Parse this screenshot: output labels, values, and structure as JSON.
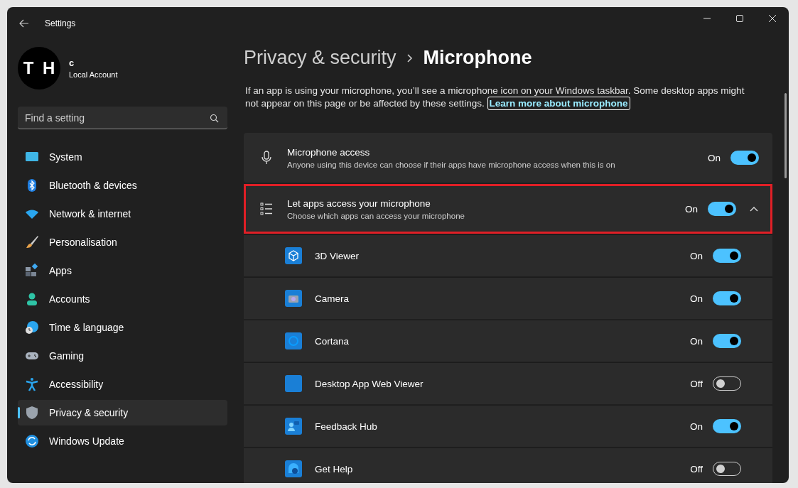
{
  "window": {
    "title": "Settings"
  },
  "account": {
    "avatar_text": "T H",
    "name": "c",
    "type": "Local Account"
  },
  "search": {
    "placeholder": "Find a setting"
  },
  "sidebar": {
    "items": [
      {
        "label": "System",
        "selected": false
      },
      {
        "label": "Bluetooth & devices",
        "selected": false
      },
      {
        "label": "Network & internet",
        "selected": false
      },
      {
        "label": "Personalisation",
        "selected": false
      },
      {
        "label": "Apps",
        "selected": false
      },
      {
        "label": "Accounts",
        "selected": false
      },
      {
        "label": "Time & language",
        "selected": false
      },
      {
        "label": "Gaming",
        "selected": false
      },
      {
        "label": "Accessibility",
        "selected": false
      },
      {
        "label": "Privacy & security",
        "selected": true
      },
      {
        "label": "Windows Update",
        "selected": false
      }
    ]
  },
  "breadcrumb": {
    "parent": "Privacy & security",
    "current": "Microphone"
  },
  "intro": {
    "text": "If an app is using your microphone, you’ll see a microphone icon on your Windows taskbar. Some desktop apps might not appear on this page or be affected by these settings.",
    "link": "Learn more about microphone"
  },
  "settings": [
    {
      "kind": "mic",
      "title": "Microphone access",
      "description": "Anyone using this device can choose if their apps have microphone access when this is on",
      "state_text": "On",
      "on": true,
      "highlighted": false
    },
    {
      "kind": "list",
      "title": "Let apps access your microphone",
      "description": "Choose which apps can access your microphone",
      "state_text": "On",
      "on": true,
      "highlighted": true,
      "expanded": true
    }
  ],
  "apps": [
    {
      "name": "3D Viewer",
      "state_text": "On",
      "on": true
    },
    {
      "name": "Camera",
      "state_text": "On",
      "on": true
    },
    {
      "name": "Cortana",
      "state_text": "On",
      "on": true
    },
    {
      "name": "Desktop App Web Viewer",
      "state_text": "Off",
      "on": false
    },
    {
      "name": "Feedback Hub",
      "state_text": "On",
      "on": true
    },
    {
      "name": "Get Help",
      "state_text": "Off",
      "on": false
    }
  ]
}
